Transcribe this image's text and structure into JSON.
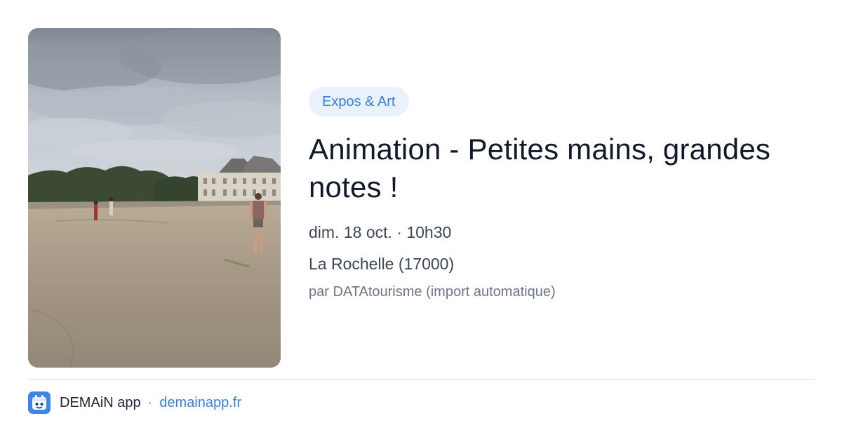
{
  "event": {
    "category": "Expos & Art",
    "title": "Animation - Petites mains, grandes notes !",
    "date": "dim. 18 oct. · 10h30",
    "location": "La Rochelle (17000)",
    "source": "par DATAtourisme (import automatique)"
  },
  "footer": {
    "app_name": "DEMAiN app",
    "separator": "·",
    "link_text": "demainapp.fr",
    "logo_icon": "demain-app-logo-icon"
  },
  "colors": {
    "accent": "#3a7fd5",
    "badge_background": "#e9f2fc",
    "logo_background": "#3d86e6"
  }
}
